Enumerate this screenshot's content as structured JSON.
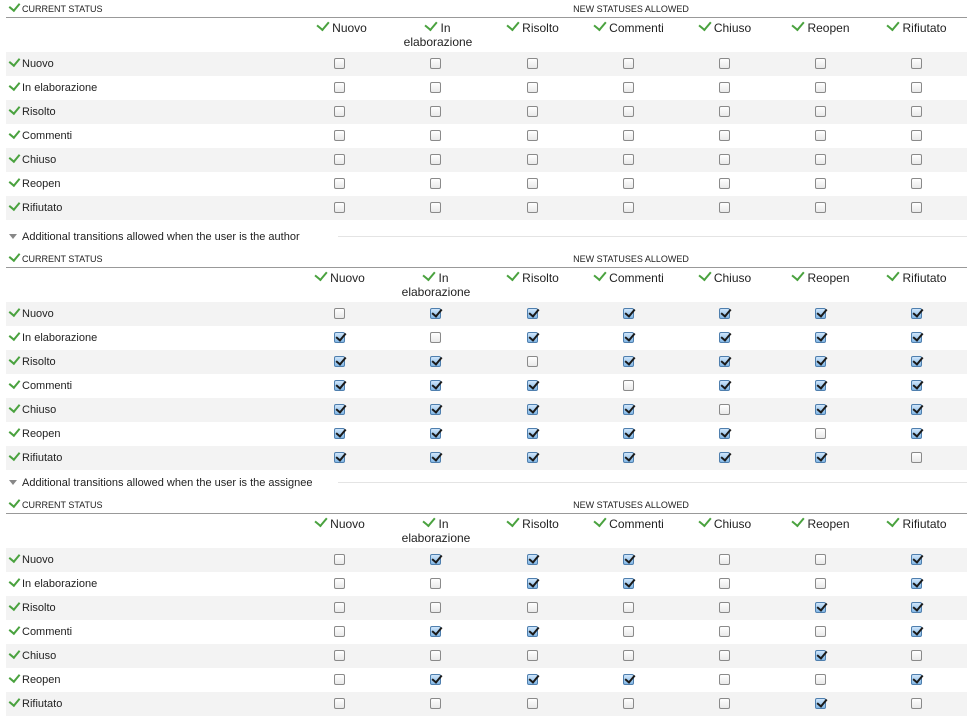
{
  "current_status_label": "Current status",
  "new_statuses_label": "New statuses allowed",
  "statuses": [
    "Nuovo",
    "In elaborazione",
    "Risolto",
    "Commenti",
    "Chiuso",
    "Reopen",
    "Rifiutato"
  ],
  "column_headers": [
    {
      "line1": "Nuovo",
      "line2": ""
    },
    {
      "line1": "In",
      "line2": "elaborazione"
    },
    {
      "line1": "Risolto",
      "line2": ""
    },
    {
      "line1": "Commenti",
      "line2": ""
    },
    {
      "line1": "Chiuso",
      "line2": ""
    },
    {
      "line1": "Reopen",
      "line2": ""
    },
    {
      "line1": "Rifiutato",
      "line2": ""
    }
  ],
  "sections": [
    {
      "title": "",
      "matrix": [
        [
          0,
          0,
          0,
          0,
          0,
          0,
          0
        ],
        [
          0,
          0,
          0,
          0,
          0,
          0,
          0
        ],
        [
          0,
          0,
          0,
          0,
          0,
          0,
          0
        ],
        [
          0,
          0,
          0,
          0,
          0,
          0,
          0
        ],
        [
          0,
          0,
          0,
          0,
          0,
          0,
          0
        ],
        [
          0,
          0,
          0,
          0,
          0,
          0,
          0
        ],
        [
          0,
          0,
          0,
          0,
          0,
          0,
          0
        ]
      ]
    },
    {
      "title": "Additional transitions allowed when the user is the author",
      "matrix": [
        [
          0,
          1,
          1,
          1,
          1,
          1,
          1
        ],
        [
          1,
          0,
          1,
          1,
          1,
          1,
          1
        ],
        [
          1,
          1,
          0,
          1,
          1,
          1,
          1
        ],
        [
          1,
          1,
          1,
          0,
          1,
          1,
          1
        ],
        [
          1,
          1,
          1,
          1,
          0,
          1,
          1
        ],
        [
          1,
          1,
          1,
          1,
          1,
          0,
          1
        ],
        [
          1,
          1,
          1,
          1,
          1,
          1,
          0
        ]
      ]
    },
    {
      "title": "Additional transitions allowed when the user is the assignee",
      "matrix": [
        [
          0,
          1,
          1,
          1,
          0,
          0,
          1
        ],
        [
          0,
          0,
          1,
          1,
          0,
          0,
          1
        ],
        [
          0,
          0,
          0,
          0,
          0,
          1,
          1
        ],
        [
          0,
          1,
          1,
          0,
          0,
          0,
          1
        ],
        [
          0,
          0,
          0,
          0,
          0,
          1,
          0
        ],
        [
          0,
          1,
          1,
          1,
          0,
          0,
          1
        ],
        [
          0,
          0,
          0,
          0,
          0,
          1,
          0
        ]
      ]
    }
  ]
}
